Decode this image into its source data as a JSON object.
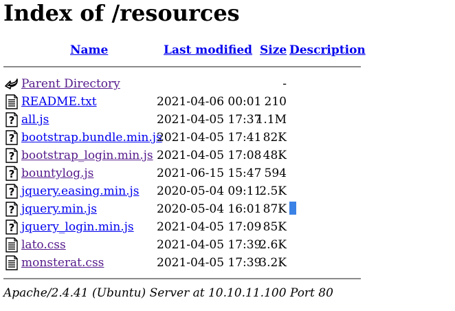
{
  "page": {
    "title": "Index of /resources",
    "footer": "Apache/2.4.41 (Ubuntu) Server at 10.10.11.100 Port 80"
  },
  "columns": {
    "name": "Name",
    "last_modified": "Last modified",
    "size": "Size",
    "description": "Description"
  },
  "parent": {
    "name": "Parent Directory",
    "size": "-"
  },
  "files": [
    {
      "name": "README.txt",
      "date": "2021-04-06 00:01",
      "size": "210",
      "icon": "text-file-icon",
      "visited": false
    },
    {
      "name": "all.js",
      "date": "2021-04-05 17:37",
      "size": "1.1M",
      "icon": "unknown-file-icon",
      "visited": false
    },
    {
      "name": "bootstrap.bundle.min.js",
      "date": "2021-04-05 17:41",
      "size": "82K",
      "icon": "unknown-file-icon",
      "visited": false
    },
    {
      "name": "bootstrap_login.min.js",
      "date": "2021-04-05 17:08",
      "size": "48K",
      "icon": "unknown-file-icon",
      "visited": true
    },
    {
      "name": "bountylog.js",
      "date": "2021-06-15 15:47",
      "size": "594",
      "icon": "unknown-file-icon",
      "visited": true
    },
    {
      "name": "jquery.easing.min.js",
      "date": "2020-05-04 09:11",
      "size": "2.5K",
      "icon": "unknown-file-icon",
      "visited": false
    },
    {
      "name": "jquery.min.js",
      "date": "2020-05-04 16:01",
      "size": "87K",
      "icon": "unknown-file-icon",
      "visited": false
    },
    {
      "name": "jquery_login.min.js",
      "date": "2021-04-05 17:09",
      "size": "85K",
      "icon": "unknown-file-icon",
      "visited": false
    },
    {
      "name": "lato.css",
      "date": "2021-04-05 17:39",
      "size": "2.6K",
      "icon": "text-file-icon",
      "visited": true
    },
    {
      "name": "monsterat.css",
      "date": "2021-04-05 17:39",
      "size": "3.2K",
      "icon": "text-file-icon",
      "visited": true
    }
  ]
}
